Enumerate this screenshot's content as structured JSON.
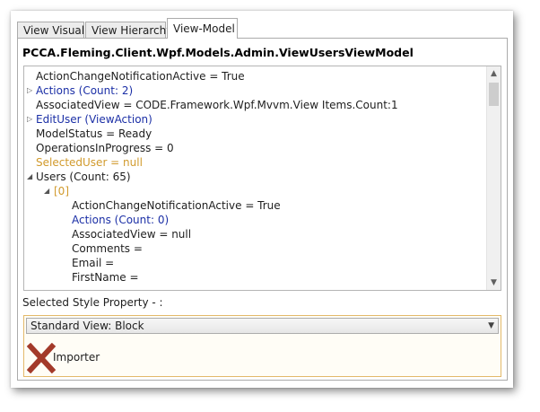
{
  "tabs": [
    {
      "label": "View Visual",
      "active": false
    },
    {
      "label": "View Hierarchy",
      "active": false
    },
    {
      "label": "View-Model",
      "active": true
    }
  ],
  "view_model": {
    "title": "PCCA.Fleming.Client.Wpf.Models.Admin.ViewUsersViewModel",
    "rows": [
      "ActionChangeNotificationActive = True",
      "Actions (Count: 2)",
      "AssociatedView = CODE.Framework.Wpf.Mvvm.View Items.Count:1",
      "EditUser (ViewAction)",
      "ModelStatus = Ready",
      "OperationsInProgress = 0",
      "SelectedUser = null",
      "Users (Count: 65)",
      "[0]",
      "ActionChangeNotificationActive = True",
      "Actions (Count: 0)",
      "AssociatedView = null",
      "Comments =",
      "Email =",
      "FirstName ="
    ]
  },
  "selected_style_property": {
    "label": "Selected Style Property - :",
    "selected_value": "Standard View: Block"
  },
  "importer": {
    "label": "Importer",
    "icon": "red-x-icon"
  },
  "colors": {
    "link": "#1b2fa6",
    "null_value": "#d19a2c",
    "style_border": "#e3b96a",
    "x_red": "#a33a2a"
  }
}
